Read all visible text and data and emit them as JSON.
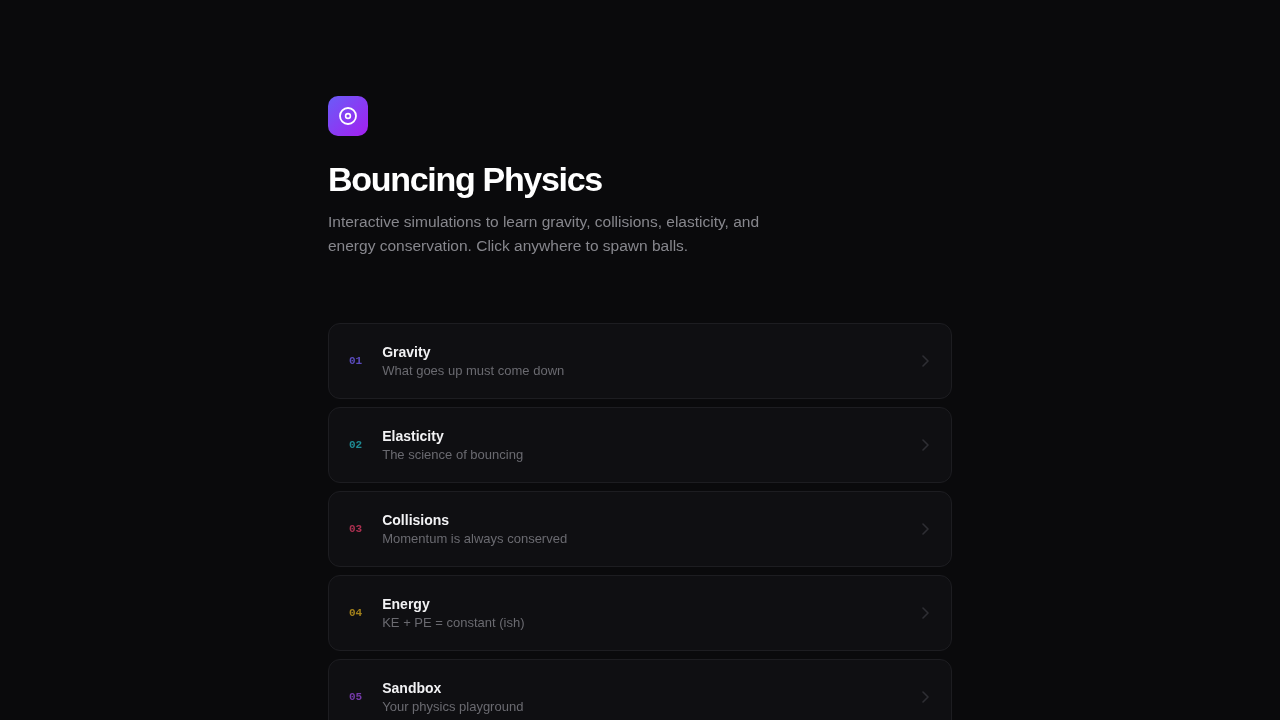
{
  "header": {
    "title": "Bouncing Physics",
    "description": "Interactive simulations to learn gravity, collisions, elasticity, and energy conservation. Click anywhere to spawn balls."
  },
  "lessons": [
    {
      "number": "01",
      "title": "Gravity",
      "subtitle": "What goes up must come down",
      "color": "#5a4bbd"
    },
    {
      "number": "02",
      "title": "Elasticity",
      "subtitle": "The science of bouncing",
      "color": "#1f8a93"
    },
    {
      "number": "03",
      "title": "Collisions",
      "subtitle": "Momentum is always conserved",
      "color": "#ab3050"
    },
    {
      "number": "04",
      "title": "Energy",
      "subtitle": "KE + PE = constant (ish)",
      "color": "#a4821c"
    },
    {
      "number": "05",
      "title": "Sandbox",
      "subtitle": "Your physics playground",
      "color": "#743aa8"
    }
  ]
}
